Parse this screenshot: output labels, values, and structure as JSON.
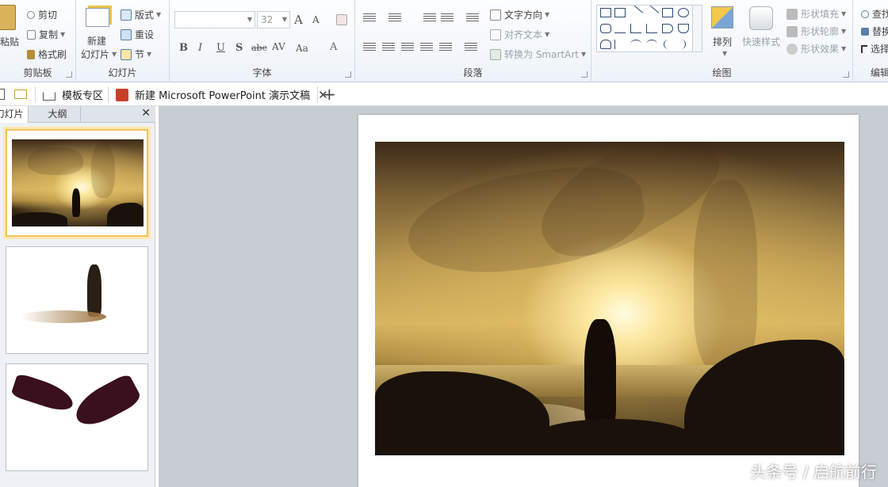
{
  "ribbon": {
    "clipboard": {
      "label": "剪贴板",
      "paste": "粘贴",
      "cut": "剪切",
      "copy": "复制",
      "format_painter": "格式刷"
    },
    "slides": {
      "label": "幻灯片",
      "new_slide_line1": "新建",
      "new_slide_line2": "幻灯片",
      "layout": "版式",
      "reset": "重设",
      "section": "节"
    },
    "font": {
      "label": "字体",
      "font_name": "",
      "font_size": "32",
      "grow": "A",
      "shrink": "A",
      "bold": "B",
      "italic": "I",
      "underline": "U",
      "shadow": "S",
      "strikethrough": "abc",
      "spacing": "AV",
      "case": "Aa",
      "color": "A"
    },
    "paragraph": {
      "label": "段落",
      "text_direction": "文字方向",
      "align_text": "对齐文本",
      "convert_smartart": "转换为 SmartArt"
    },
    "drawing": {
      "label": "绘图",
      "arrange": "排列",
      "quick_styles": "快速样式",
      "shape_fill": "形状填充",
      "shape_outline": "形状轮廓",
      "shape_effects": "形状效果"
    },
    "editing": {
      "label": "编辑",
      "find": "查找",
      "replace": "替换",
      "select": "选择"
    }
  },
  "tabs": [
    {
      "label": "模板专区",
      "icon": "home-icon"
    },
    {
      "label": "新建 Microsoft PowerPoint 演示文稿",
      "icon": "powerpoint-file-icon",
      "closable": true
    }
  ],
  "left_pane": {
    "tab_slides": "幻灯片",
    "tab_outline": "大纲",
    "thumbnails": [
      {
        "content": "sunset-couple-photo",
        "selected": true
      },
      {
        "content": "couple-silhouette-cutout",
        "selected": false
      },
      {
        "content": "hands-silhouette",
        "selected": false
      }
    ]
  },
  "watermark": "头条号 / 启航前行",
  "colors": {
    "ribbon_bg": "#eef3f9",
    "workspace_bg": "#c8cdd4",
    "selected_thumb": "#f3c35b",
    "ppt_icon": "#c8402a"
  }
}
